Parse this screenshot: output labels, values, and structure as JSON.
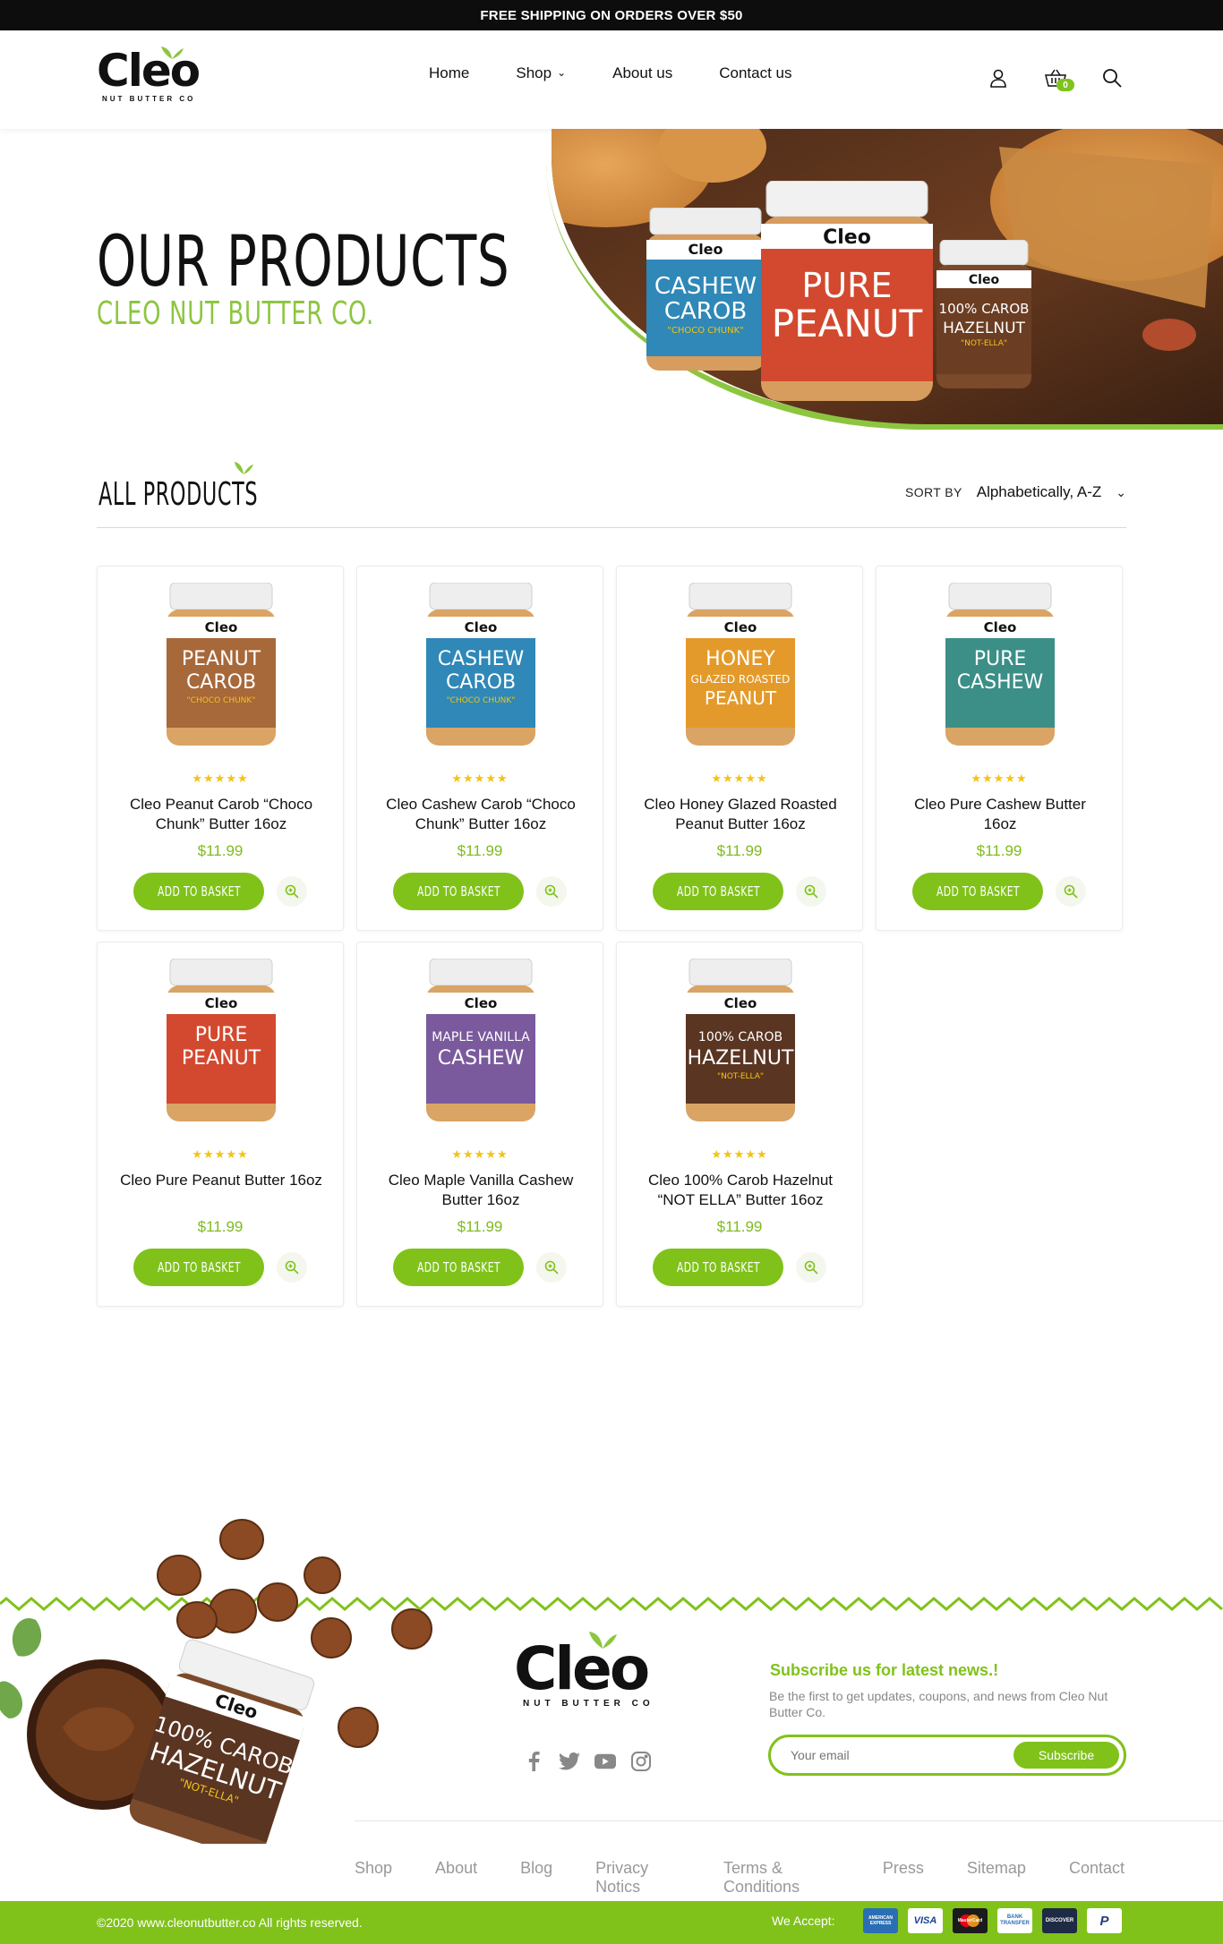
{
  "topbar": {
    "text": "FREE SHIPPING ON ORDERS OVER $50"
  },
  "header": {
    "logo": {
      "word": "Cleo",
      "tagline": "NUT BUTTER CO"
    },
    "nav": [
      {
        "label": "Home"
      },
      {
        "label": "Shop"
      },
      {
        "label": "About us"
      },
      {
        "label": "Contact us"
      }
    ],
    "cart_count": "0"
  },
  "hero": {
    "title": "OUR PRODUCTS",
    "subtitle": "CLEO NUT BUTTER CO.",
    "jars": [
      {
        "line1": "CASHEW",
        "line2": "CAROB",
        "sub": "\"CHOCO CHUNK\"",
        "color": "#2f88b7"
      },
      {
        "line1": "PURE",
        "line2": "PEANUT",
        "sub": "",
        "color": "#d3492f"
      },
      {
        "line1": "100% CAROB",
        "line2": "HAZELNUT",
        "sub": "\"NOT-ELLA\"",
        "color": "#6b3d23"
      }
    ]
  },
  "catalog": {
    "heading": "ALL PRODUCTS",
    "sort_label": "SORT BY",
    "sort_value": "Alphabetically, A-Z",
    "add_label": "ADD TO BASKET",
    "stars": "★★★★★",
    "products": [
      {
        "name": "Cleo Peanut Carob “Choco Chunk” Butter 16oz",
        "price": "$11.99",
        "jar": {
          "line1": "PEANUT",
          "line2": "CAROB",
          "sub": "\"CHOCO CHUNK\"",
          "color": "#a7683a"
        }
      },
      {
        "name": "Cleo Cashew Carob “Choco Chunk” Butter 16oz",
        "price": "$11.99",
        "jar": {
          "line1": "CASHEW",
          "line2": "CAROB",
          "sub": "\"CHOCO CHUNK\"",
          "color": "#2f88b7"
        }
      },
      {
        "name": "Cleo Honey Glazed Roasted Peanut Butter 16oz",
        "price": "$11.99",
        "jar": {
          "line1": "HONEY",
          "line2": "GLAZED ROASTED",
          "sub": "PEANUT",
          "color": "#e49a2a"
        }
      },
      {
        "name": "Cleo Pure Cashew Butter 16oz",
        "price": "$11.99",
        "jar": {
          "line1": "PURE",
          "line2": "CASHEW",
          "sub": "",
          "color": "#3b8f87"
        }
      },
      {
        "name": "Cleo Pure Peanut Butter 16oz",
        "price": "$11.99",
        "jar": {
          "line1": "PURE",
          "line2": "PEANUT",
          "sub": "",
          "color": "#d3492f"
        }
      },
      {
        "name": "Cleo Maple Vanilla Cashew Butter 16oz",
        "price": "$11.99",
        "jar": {
          "line1": "MAPLE VANILLA",
          "line2": "CASHEW",
          "sub": "",
          "color": "#7a5a9d"
        }
      },
      {
        "name": "Cleo 100% Carob Hazelnut “NOT ELLA” Butter 16oz",
        "price": "$11.99",
        "jar": {
          "line1": "100% CAROB",
          "line2": "HAZELNUT",
          "sub": "\"NOT-ELLA\"",
          "color": "#5a3522"
        }
      }
    ]
  },
  "footer": {
    "logo": {
      "word": "Cleo",
      "tagline": "NUT BUTTER CO"
    },
    "art_jar": {
      "line1": "100% CAROB",
      "line2": "HAZELNUT",
      "sub": "\"NOT-ELLA\""
    },
    "subscribe_title": "Subscribe us for latest news.!",
    "subscribe_desc": "Be the first to get updates, coupons, and news from Cleo Nut Butter Co.",
    "email_placeholder": "Your email",
    "subscribe_button": "Subscribe",
    "links": [
      "Shop",
      "About",
      "Blog",
      "Privacy Notics",
      "Terms & Conditions",
      "Press",
      "Sitemap",
      "Contact"
    ],
    "copyright": "©2020 www.cleonutbutter.co All rights reserved.",
    "accept_label": "We Accept:",
    "payments": [
      "AMERICAN EXPRESS",
      "VISA",
      "MasterCard",
      "BANK TRANSFER",
      "DISCOVER",
      "P"
    ],
    "accent": "#80c21a"
  }
}
